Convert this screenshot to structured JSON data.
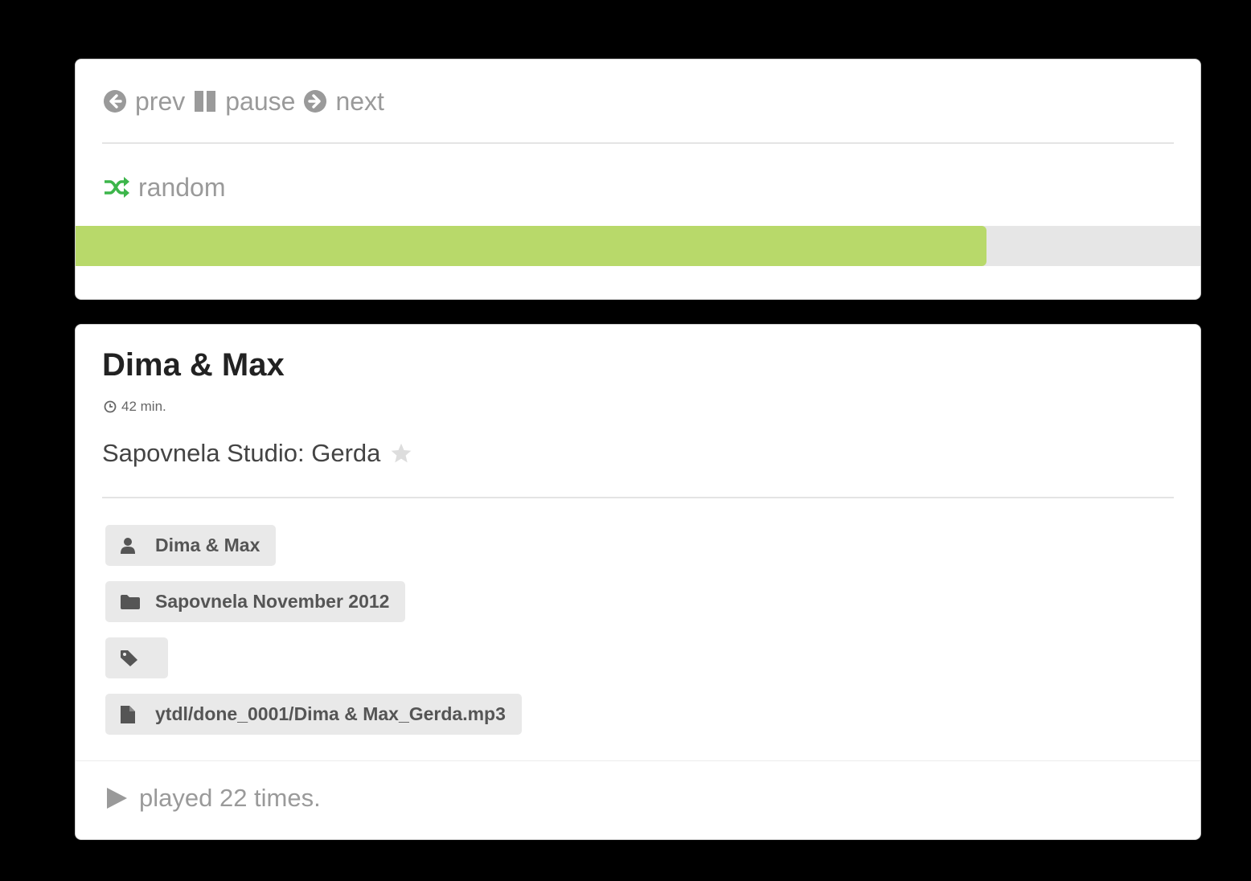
{
  "controls": {
    "prev_label": "prev",
    "pause_label": "pause",
    "next_label": "next",
    "random_label": "random",
    "progress_fraction": 0.81
  },
  "track": {
    "title": "Dima & Max",
    "duration": "42 min.",
    "subtitle": "Sapovnela Studio: Gerda",
    "artist": "Dima & Max",
    "album": "Sapovnela November 2012",
    "tags": "",
    "file_path": "ytdl/done_0001/Dima & Max_Gerda.mp3",
    "play_count_text": "played 22 times."
  },
  "colors": {
    "random_accent": "#3cb54a",
    "progress_fill": "#b8d96a",
    "progress_track": "#e6e6e6"
  },
  "icons": {
    "prev": "arrow-circle-left-icon",
    "pause": "pause-icon",
    "next": "arrow-circle-right-icon",
    "random": "shuffle-icon",
    "duration": "clock-icon",
    "favorite": "star-icon",
    "artist": "user-icon",
    "album": "folder-icon",
    "tags": "tag-icon",
    "file": "file-icon",
    "plays": "play-icon"
  }
}
